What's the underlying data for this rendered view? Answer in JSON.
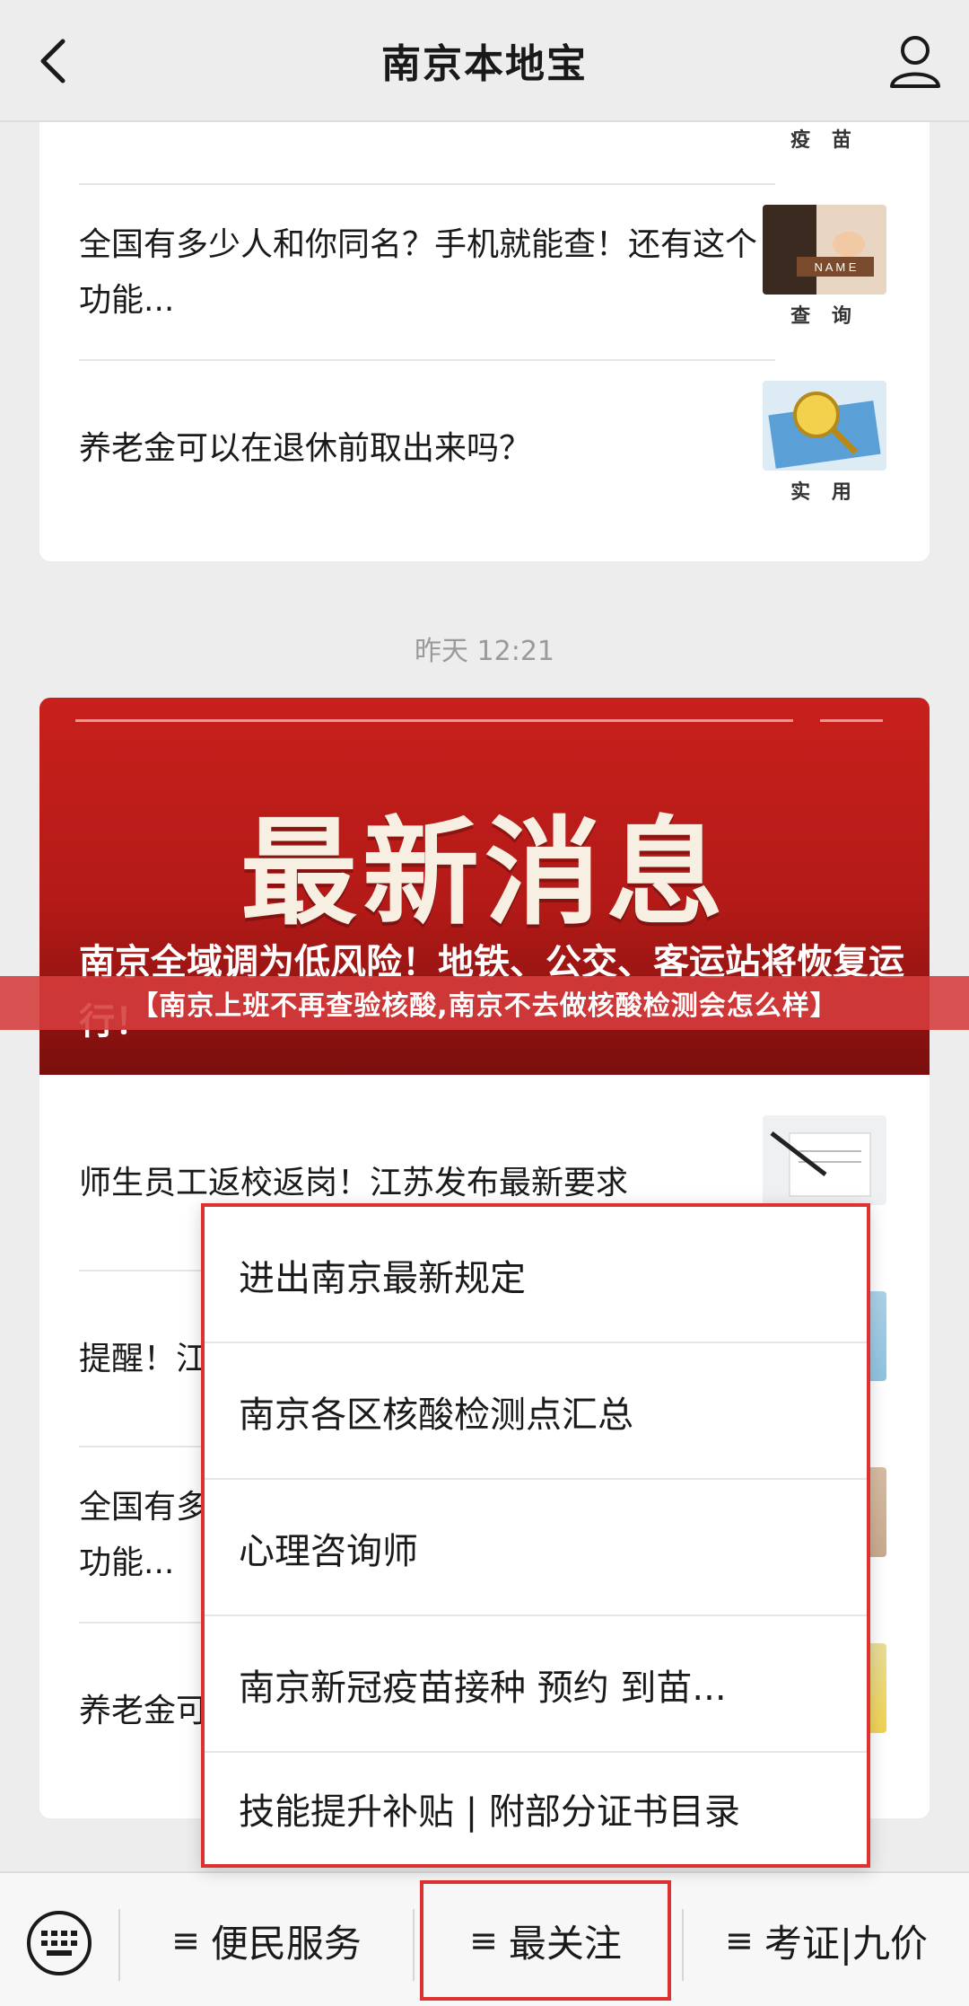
{
  "header": {
    "title": "南京本地宝"
  },
  "top_card": {
    "articles": [
      {
        "title": "",
        "thumb_label": "疫 苗"
      },
      {
        "title": "全国有多少人和你同名？手机就能查！还有这个功能...",
        "thumb_label": "查 询"
      },
      {
        "title": "养老金可以在退休前取出来吗？",
        "thumb_label": "实 用"
      }
    ]
  },
  "timestamp": "昨天 12:21",
  "hero": {
    "big_text": "最新消息",
    "subtitle": "南京全域调为低风险！地铁、公交、客运站将恢复运行！"
  },
  "overlay_caption": "【南京上班不再查验核酸,南京不去做核酸检测会怎么样】",
  "main_card": {
    "articles": [
      {
        "title": "师生员工返校返岗！江苏发布最新要求"
      },
      {
        "title": "提醒！江"
      },
      {
        "title": "全国有多少人和你同名？手机就能查！还有这个功能..."
      },
      {
        "title": "养老金可以在退休前取出来吗？"
      }
    ]
  },
  "popup_menu": {
    "items": [
      "进出南京最新规定",
      "南京各区核酸检测点汇总",
      "心理咨询师",
      "南京新冠疫苗接种 预约 到苗...",
      "技能提升补贴 | 附部分证书目录"
    ]
  },
  "bottom_bar": {
    "menu_glyph": "≡",
    "items": [
      "便民服务",
      "最关注",
      "考证|九价"
    ]
  },
  "colors": {
    "highlight_red": "#e03131",
    "hero_red": "#c8201c",
    "background": "#ededed"
  }
}
